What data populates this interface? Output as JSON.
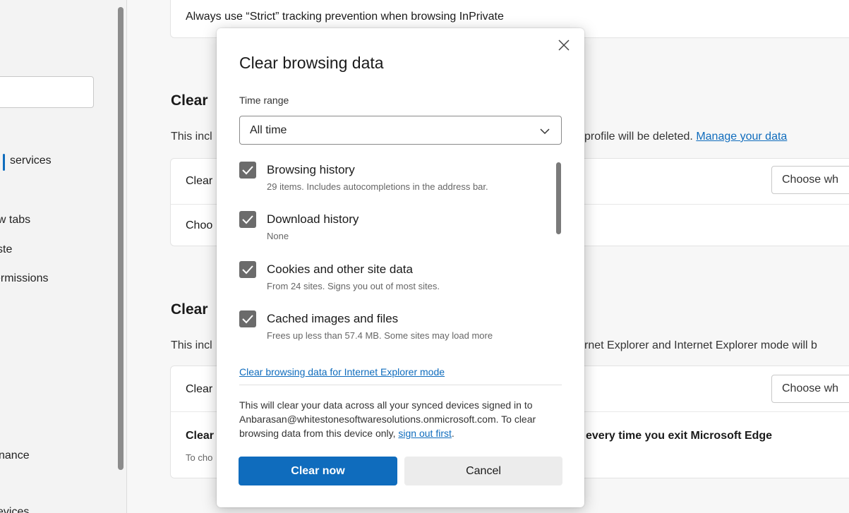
{
  "sidebar": {
    "items": [
      {
        "label": "services"
      },
      {
        "label": "ew tabs"
      },
      {
        "label": "ste"
      },
      {
        "label": "ermissions"
      },
      {
        "label": "nance"
      },
      {
        "label": "evices"
      }
    ]
  },
  "background": {
    "top_card_text": "Always use “Strict” tracking prevention when browsing InPrivate",
    "section1": {
      "heading": "Clear",
      "desc_left": "This incl",
      "desc_right": "profile will be deleted.",
      "desc_link": "Manage your data",
      "row1_left": "Clear",
      "row1_button": "Choose wh",
      "row2_left": "Choo"
    },
    "section2": {
      "heading": "Clear",
      "desc_left": "This incl",
      "desc_right": "rnet Explorer and Internet Explorer mode will b",
      "row1_left": "Clear",
      "row1_button": "Choose wh",
      "row2_left": "Clear",
      "row2_right": "every time you exit Microsoft Edge",
      "row2_sub": "To cho"
    }
  },
  "dialog": {
    "title": "Clear browsing data",
    "time_range_label": "Time range",
    "time_range_value": "All time",
    "options": [
      {
        "title": "Browsing history",
        "sub": "29 items. Includes autocompletions in the address bar.",
        "checked": true
      },
      {
        "title": "Download history",
        "sub": "None",
        "checked": true
      },
      {
        "title": "Cookies and other site data",
        "sub": "From 24 sites. Signs you out of most sites.",
        "checked": true
      },
      {
        "title": "Cached images and files",
        "sub": "Frees up less than 57.4 MB. Some sites may load more",
        "checked": true
      }
    ],
    "ie_link": "Clear browsing data for Internet Explorer mode",
    "sync_text_1": "This will clear your data across all your synced devices signed in to Anbarasan@whitestonesoftwaresolutions.onmicrosoft.com. To clear browsing data from this device only,",
    "sync_link": "sign out first",
    "sync_text_2": ".",
    "clear_button": "Clear now",
    "cancel_button": "Cancel"
  },
  "colors": {
    "accent": "#0f6cbd",
    "checkbox": "#6b6b6b"
  }
}
